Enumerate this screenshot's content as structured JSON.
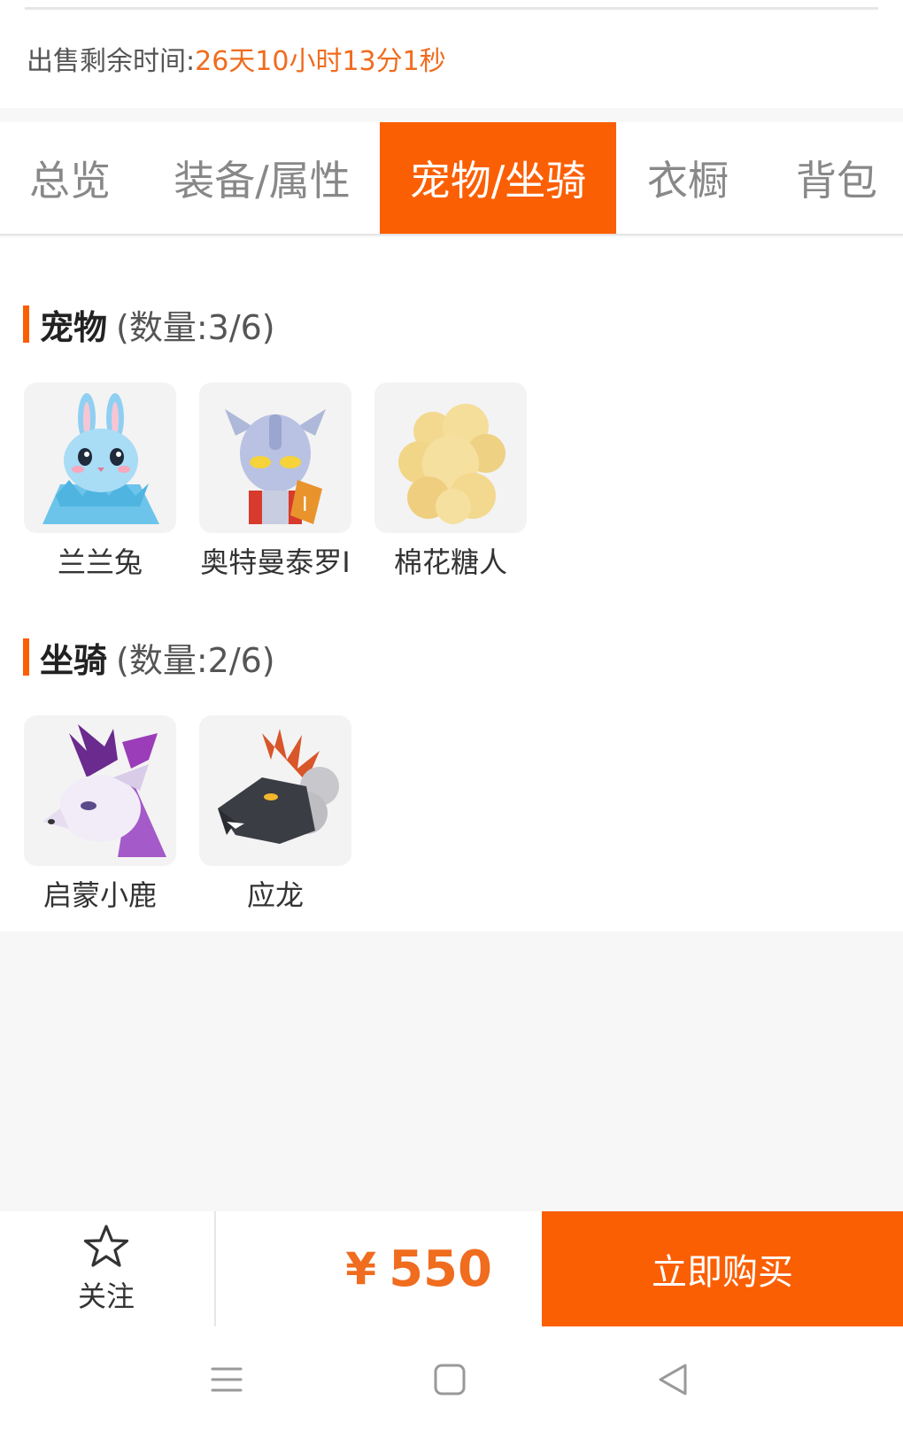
{
  "countdown": {
    "label": "出售剩余时间:",
    "value": "26天10小时13分1秒"
  },
  "tabs": [
    {
      "label": "总览"
    },
    {
      "label": "装备/属性"
    },
    {
      "label": "宠物/坐骑"
    },
    {
      "label": "衣橱"
    },
    {
      "label": "背包"
    }
  ],
  "active_tab": "宠物/坐骑",
  "pets": {
    "title": "宠物",
    "count": "(数量:3/6)",
    "items": [
      {
        "name": "兰兰兔",
        "icon": "blue-rabbit-icon"
      },
      {
        "name": "奥特曼泰罗I",
        "icon": "ultraman-taro-icon"
      },
      {
        "name": "棉花糖人",
        "icon": "marshmallow-man-icon"
      }
    ]
  },
  "mounts": {
    "title": "坐骑",
    "count": "(数量:2/6)",
    "items": [
      {
        "name": "启蒙小鹿",
        "icon": "white-deer-icon"
      },
      {
        "name": "应龙",
        "icon": "dragon-icon"
      }
    ]
  },
  "bottom": {
    "follow_label": "关注",
    "follow_icon": "star-outline-icon",
    "currency": "¥",
    "price": "550",
    "buy_label": "立即购买"
  },
  "navbar": {
    "icons": [
      "menu-icon",
      "home-square-icon",
      "back-triangle-icon"
    ]
  },
  "colors": {
    "accent": "#fb5f04",
    "price": "#f06c1e",
    "background": "#f7f7f7"
  }
}
